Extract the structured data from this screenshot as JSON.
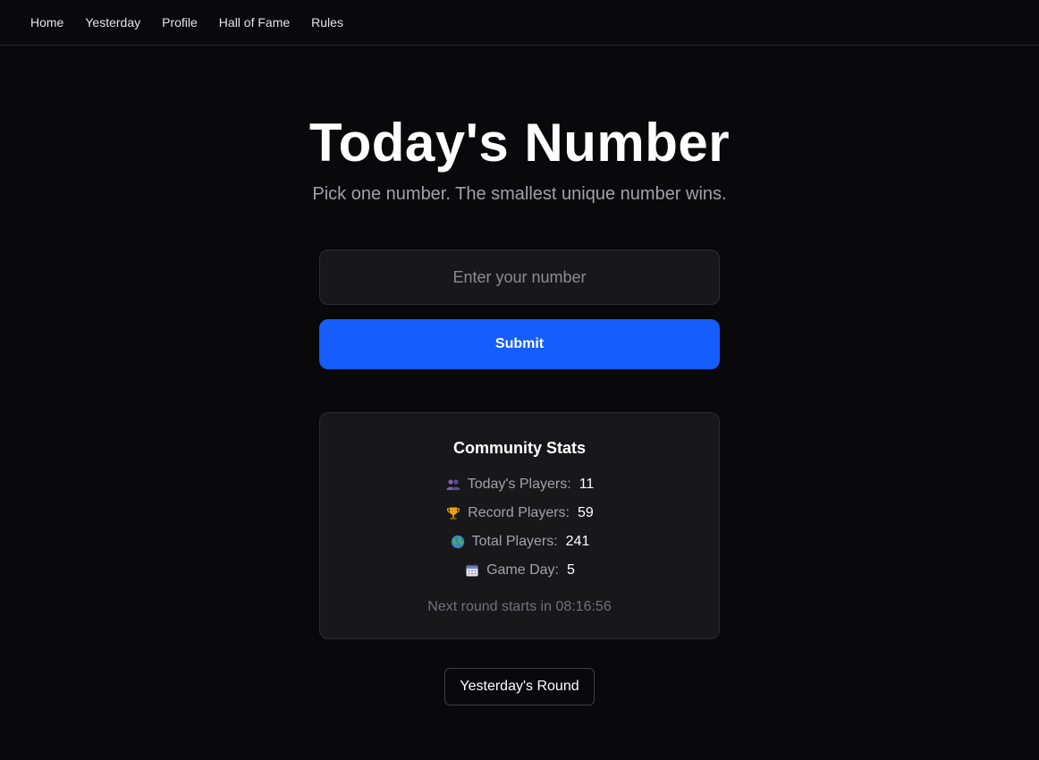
{
  "nav": {
    "items": [
      {
        "label": "Home"
      },
      {
        "label": "Yesterday"
      },
      {
        "label": "Profile"
      },
      {
        "label": "Hall of Fame"
      },
      {
        "label": "Rules"
      }
    ]
  },
  "hero": {
    "title": "Today's Number",
    "subtitle": "Pick one number. The smallest unique number wins."
  },
  "form": {
    "number_placeholder": "Enter your number",
    "number_value": "",
    "submit_label": "Submit",
    "accent_color": "#155dfc"
  },
  "stats": {
    "title": "Community Stats",
    "items": [
      {
        "icon": "people-icon",
        "label": "Today's Players:",
        "value": "11"
      },
      {
        "icon": "trophy-icon",
        "label": "Record Players:",
        "value": "59"
      },
      {
        "icon": "globe-icon",
        "label": "Total Players:",
        "value": "241"
      },
      {
        "icon": "calendar-icon",
        "label": "Game Day:",
        "value": "5"
      }
    ],
    "next_round": "Next round starts in 08:16:56"
  },
  "footer": {
    "yesterday_round_label": "Yesterday's Round"
  }
}
